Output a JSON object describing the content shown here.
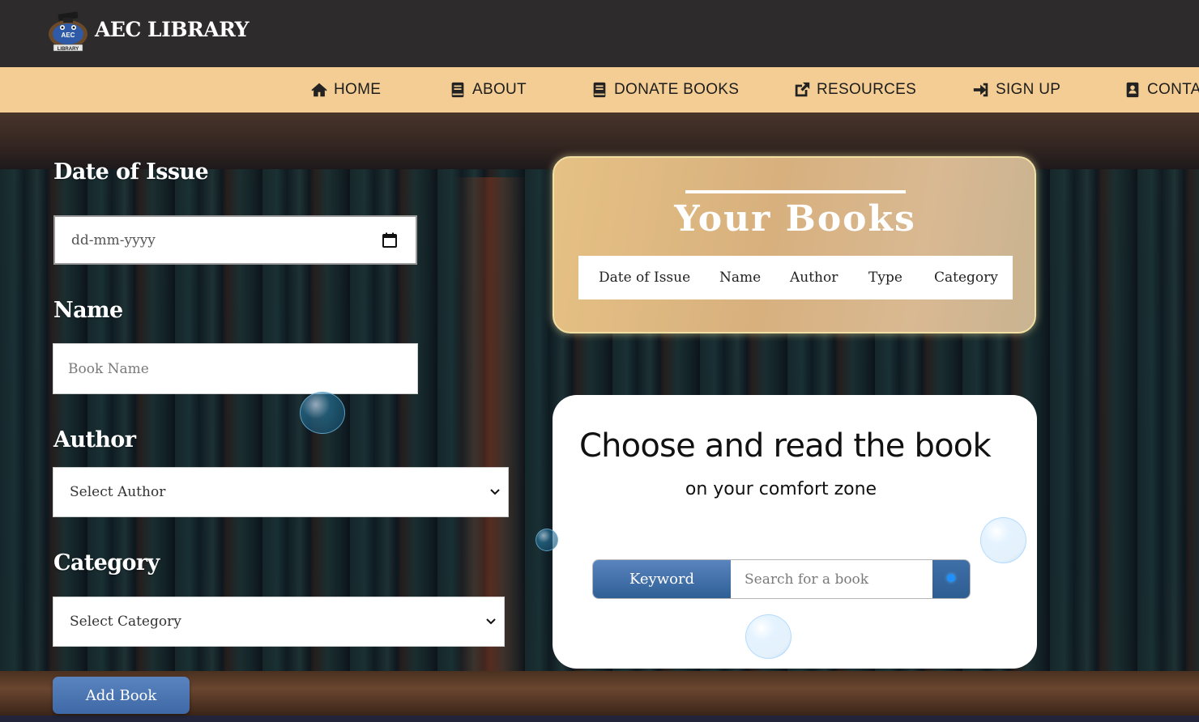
{
  "header": {
    "brand": "AEC LIBRARY",
    "logo_text": "AEC",
    "logo_sub": "LIBRARY"
  },
  "nav": [
    {
      "label": "HOME",
      "icon": "home-icon"
    },
    {
      "label": "ABOUT",
      "icon": "book-icon"
    },
    {
      "label": "DONATE BOOKS",
      "icon": "book-icon"
    },
    {
      "label": "RESOURCES",
      "icon": "external-link-icon"
    },
    {
      "label": "SIGN UP",
      "icon": "sign-in-icon"
    },
    {
      "label": "CONTAC",
      "icon": "contact-book-icon"
    }
  ],
  "form": {
    "date_label": "Date of Issue",
    "date_placeholder": "dd-mm-yyyy",
    "name_label": "Name",
    "name_placeholder": "Book Name",
    "author_label": "Author",
    "author_selected": "Select Author",
    "category_label": "Category",
    "category_selected": "Select Category",
    "add_button": "Add Book"
  },
  "your_books": {
    "title": "Your Books",
    "columns": [
      "Date of Issue",
      "Name",
      "Author",
      "Type",
      "Category"
    ]
  },
  "choose": {
    "title": "Choose and read the book",
    "subtitle": "on your comfort zone",
    "keyword_button": "Keyword",
    "search_placeholder": "Search for a book"
  },
  "colors": {
    "topbar": "#2d2b2c",
    "navbar": "#f3cd93",
    "button_blue": "#4a75b2",
    "card_gold": "#dcb580"
  }
}
